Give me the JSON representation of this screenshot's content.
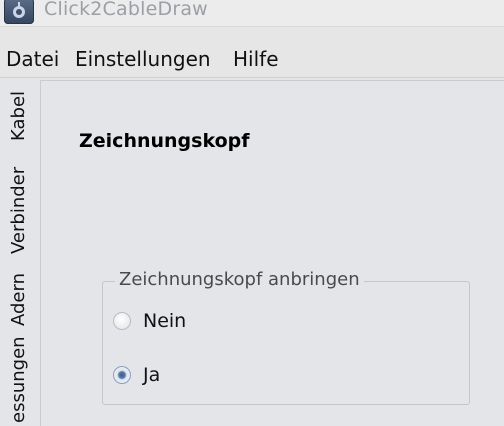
{
  "window": {
    "title": "Click2CableDraw",
    "app_icon": "app-logo-icon"
  },
  "menubar": {
    "items": [
      "Datei",
      "Einstellungen",
      "Hilfe"
    ]
  },
  "tabs": [
    "Kabel",
    "Verbinder",
    "Adern",
    "essungen"
  ],
  "panel": {
    "title": "Zeichnungskopf",
    "group": {
      "legend": "Zeichnungskopf anbringen",
      "options": [
        {
          "label": "Nein",
          "checked": false
        },
        {
          "label": "Ja",
          "checked": true
        }
      ]
    }
  },
  "colors": {
    "background": "#e3e5e8",
    "title_text": "#9aa0a6",
    "radio_checked": "#3c5e8e"
  }
}
